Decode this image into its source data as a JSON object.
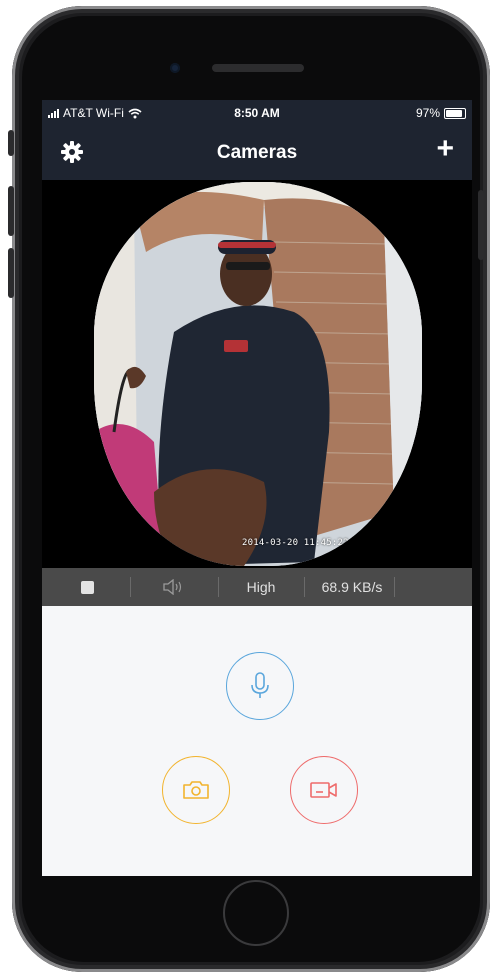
{
  "status_bar": {
    "carrier": "AT&T Wi-Fi",
    "time": "8:50 AM",
    "battery": "97%",
    "battery_level": 0.97
  },
  "nav": {
    "title": "Cameras",
    "settings_icon": "gear-icon",
    "add_icon": "plus-icon"
  },
  "video": {
    "timestamp": "2014-03-20  11:45:22   (S)"
  },
  "toolbar": {
    "stop_icon": "stop-icon",
    "speaker_icon": "speaker-icon",
    "quality": "High",
    "bitrate": "68.9 KB/s"
  },
  "controls": {
    "mic_icon": "microphone-icon",
    "snapshot_icon": "camera-icon",
    "record_icon": "video-record-icon",
    "colors": {
      "mic": "#5aa6dc",
      "snapshot": "#f2b42e",
      "record": "#ee6b6b"
    }
  }
}
